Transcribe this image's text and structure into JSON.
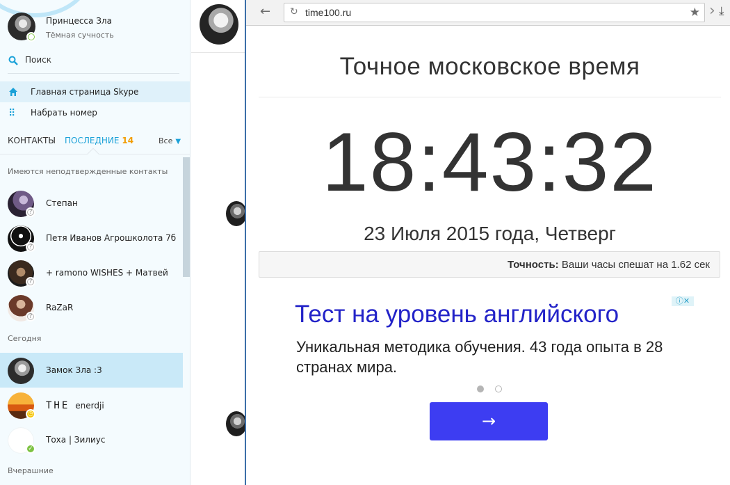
{
  "profile": {
    "name": "Принцесса Зла",
    "mood": "Тёмная сучность"
  },
  "search": {
    "label": "Поиск"
  },
  "nav": {
    "home": "Главная страница Skype",
    "dial": "Набрать номер"
  },
  "tabs": {
    "contacts": "КОНТАКТЫ",
    "recent": "ПОСЛЕДНИЕ",
    "recent_count": "14",
    "filter": "Все"
  },
  "sections": {
    "unconfirmed": "Имеются неподтвержденные контакты",
    "today": "Сегодня",
    "yesterday": "Вчерашние"
  },
  "contacts": [
    {
      "name": "Степан",
      "status": "pending"
    },
    {
      "name": "Петя Иванов Агрошколота 7б",
      "status": "pending"
    },
    {
      "name": "+ ramono WISHES + Матвей",
      "status": "pending"
    },
    {
      "name": "RaZaR",
      "status": "pending"
    },
    {
      "name": "Замок Зла :3",
      "status": "none"
    },
    {
      "name_prefix": "THE",
      "name": "enerdji",
      "status": "away"
    },
    {
      "name": "Тоха | Зилиус",
      "status": "online"
    }
  ],
  "icons": {
    "search": "search-icon",
    "home": "home-icon",
    "dialpad": "dialpad-icon",
    "back": "back-arrow-icon",
    "reload": "reload-icon",
    "star": "star-icon",
    "download": "download-icon",
    "adchoices": "adchoices-icon",
    "arrow": "arrow-right-icon"
  },
  "browser": {
    "url": "time100.ru"
  },
  "page": {
    "title": "Точное московское время",
    "time": "18:43:32",
    "date": "23 Июля 2015 года, Четверг",
    "accuracy_label": "Точность:",
    "accuracy_text": "Ваши часы спешат на 1.62 сек"
  },
  "ad": {
    "title": "Тест на уровень английского",
    "text": "Уникальная методика обучения. 43 года опыта в 28 странах мира."
  },
  "colors": {
    "skype_blue": "#1aa1d8",
    "recent_count": "#f29c00",
    "ad_title": "#2323c8",
    "ad_button": "#3d3df2",
    "online": "#7cc242"
  }
}
